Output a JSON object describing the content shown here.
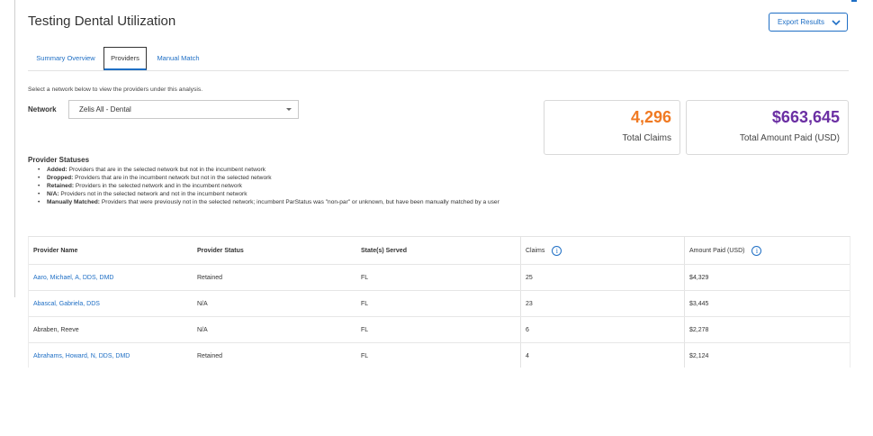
{
  "page": {
    "title": "Testing Dental Utilization",
    "export_label": "Export Results",
    "accent_color": "#1f6fc5"
  },
  "tabs": [
    {
      "label": "Summary Overview",
      "active": false
    },
    {
      "label": "Providers",
      "active": true
    },
    {
      "label": "Manual Match",
      "active": false
    }
  ],
  "network": {
    "instructions": "Select a network below to view the providers under this analysis.",
    "label": "Network",
    "selected": "Zelis All - Dental"
  },
  "stats": {
    "claims_value": "4,296",
    "claims_label": "Total Claims",
    "claims_color": "#f07a23",
    "paid_value": "$663,645",
    "paid_label": "Total Amount Paid (USD)",
    "paid_color": "#6b2fa3"
  },
  "statuses": {
    "title": "Provider Statuses",
    "items": [
      {
        "term": "Added:",
        "desc": "Providers that are in the selected network but not in the incumbent network"
      },
      {
        "term": "Dropped:",
        "desc": "Providers that are in the incumbent network but not in the selected network"
      },
      {
        "term": "Retained:",
        "desc": "Providers in the selected network and in the incumbent network"
      },
      {
        "term": "N/A:",
        "desc": "Providers not in the selected network and not in the incumbent network"
      },
      {
        "term": "Manually Matched:",
        "desc": "Providers that were previously not in the selected network; incumbent ParStatus was \"non-par\" or unknown, but have been manually matched by a user"
      }
    ]
  },
  "table": {
    "headers": [
      "Provider Name",
      "Provider Status",
      "State(s) Served",
      "Claims",
      "Amount Paid (USD)"
    ],
    "rows": [
      {
        "name": "Aaro, Michael, A, DDS, DMD",
        "status": "Retained",
        "state": "FL",
        "claims": "25",
        "paid": "$4,329",
        "linked": true
      },
      {
        "name": "Abascal, Gabriela, DDS",
        "status": "N/A",
        "state": "FL",
        "claims": "23",
        "paid": "$3,445",
        "linked": true
      },
      {
        "name": "Abraben, Reeve",
        "status": "N/A",
        "state": "FL",
        "claims": "6",
        "paid": "$2,278",
        "linked": false
      },
      {
        "name": "Abrahams, Howard, N, DDS, DMD",
        "status": "Retained",
        "state": "FL",
        "claims": "4",
        "paid": "$2,124",
        "linked": true
      }
    ]
  }
}
